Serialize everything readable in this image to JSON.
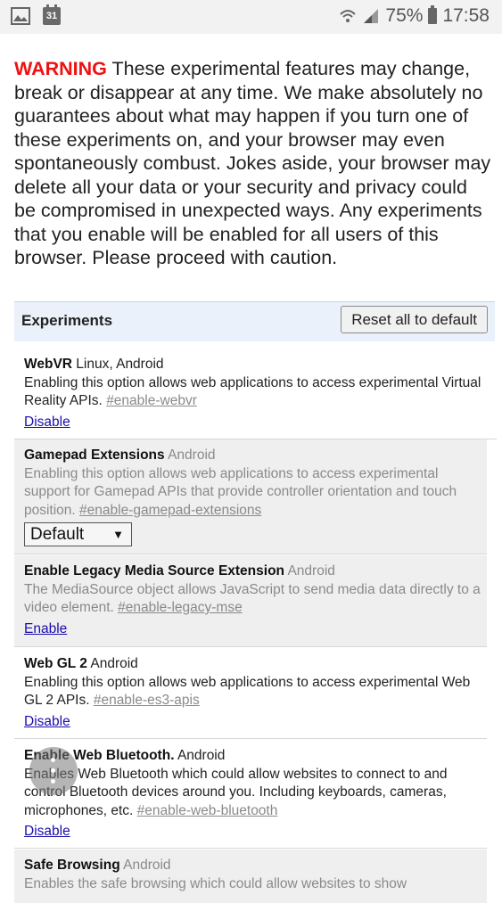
{
  "status_bar": {
    "calendar_day": "31",
    "battery": "75%",
    "time": "17:58"
  },
  "warning": {
    "label": "WARNING",
    "text": " These experimental features may change, break or disappear at any time. We make absolutely no guarantees about what may happen if you turn one of these experiments on, and your browser may even spontaneously combust. Jokes aside, your browser may delete all your data or your security and privacy could be compromised in unexpected ways. Any experiments that you enable will be enabled for all users of this browser. Please proceed with caution."
  },
  "experiments": {
    "title": "Experiments",
    "reset_label": "Reset all to default",
    "items": [
      {
        "name": "WebVR",
        "platforms": " Linux, Android",
        "description": "Enabling this option allows web applications to access experimental Virtual Reality APIs. ",
        "flag": "#enable-webvr",
        "action": "Disable"
      },
      {
        "name": "Gamepad Extensions",
        "platforms": " Android",
        "description": "Enabling this option allows web applications to access experimental support for Gamepad APIs that provide controller orientation and touch position. ",
        "flag": "#enable-gamepad-extensions",
        "select_value": "Default"
      },
      {
        "name": "Enable Legacy Media Source Extension",
        "platforms": " Android",
        "description": "The MediaSource object allows JavaScript to send media data directly to a video element. ",
        "flag": "#enable-legacy-mse",
        "action": "Enable"
      },
      {
        "name": "Web GL 2",
        "platforms": " Android",
        "description": "Enabling this option allows web applications to access experimental Web GL 2 APIs. ",
        "flag": "#enable-es3-apis",
        "action": "Disable"
      },
      {
        "name": "Enable Web Bluetooth.",
        "platforms": " Android",
        "description": "Enables Web Bluetooth which could allow websites to connect to and control Bluetooth devices around you. Including keyboards, cameras, microphones, etc. ",
        "flag": "#enable-web-bluetooth",
        "action": "Disable"
      },
      {
        "name": "Safe Browsing",
        "platforms": " Android",
        "description": "Enables the safe browsing which could allow websites to show"
      }
    ]
  }
}
